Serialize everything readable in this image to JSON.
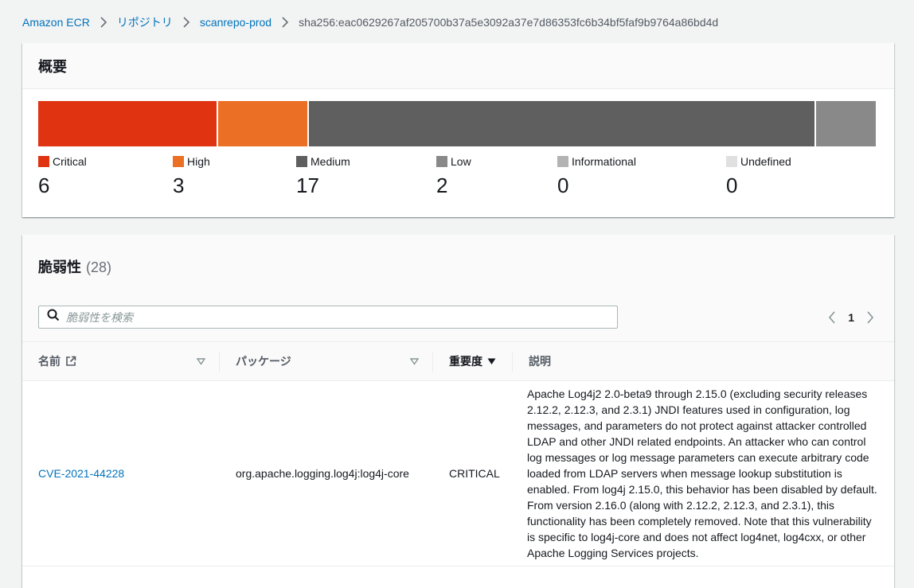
{
  "breadcrumb": {
    "items": [
      "Amazon ECR",
      "リポジトリ",
      "scanrepo-prod"
    ],
    "current": "sha256:eac0629267af205700b37a5e3092a37e7d86353fc6b34bf5faf9b9764a86bd4d"
  },
  "summary": {
    "title": "概要",
    "severities": [
      {
        "label": "Critical",
        "count": "6",
        "color": "#df3312"
      },
      {
        "label": "High",
        "count": "3",
        "color": "#eb6f24"
      },
      {
        "label": "Medium",
        "count": "17",
        "color": "#5f5f5f"
      },
      {
        "label": "Low",
        "count": "2",
        "color": "#898989"
      },
      {
        "label": "Informational",
        "count": "0",
        "color": "#b3b3b3"
      },
      {
        "label": "Undefined",
        "count": "0",
        "color": "#e0e0e0"
      }
    ]
  },
  "vulnerabilities": {
    "title": "脆弱性",
    "count": "(28)",
    "search_placeholder": "脆弱性を検索",
    "page": "1",
    "columns": {
      "name": "名前",
      "package": "パッケージ",
      "severity": "重要度",
      "description": "説明"
    },
    "rows": [
      {
        "name": "CVE-2021-44228",
        "package": "org.apache.logging.log4j:log4j-core",
        "severity": "CRITICAL",
        "description": "Apache Log4j2 2.0-beta9 through 2.15.0 (excluding security releases 2.12.2, 2.12.3, and 2.3.1) JNDI features used in configuration, log messages, and parameters do not protect against attacker controlled LDAP and other JNDI related endpoints. An attacker who can control log messages or log message parameters can execute arbitrary code loaded from LDAP servers when message lookup substitution is enabled. From log4j 2.15.0, this behavior has been disabled by default. From version 2.16.0 (along with 2.12.2, 2.12.3, and 2.3.1), this functionality has been completely removed. Note that this vulnerability is specific to log4j-core and does not affect log4net, log4cxx, or other Apache Logging Services projects."
      }
    ]
  },
  "colors": {
    "link": "#0073bb",
    "critical": "#df3312",
    "high": "#eb6f24",
    "medium": "#5f5f5f",
    "low": "#898989"
  },
  "icons": [
    "chevron-right-icon",
    "search-icon",
    "chevron-left-icon",
    "external-link-icon",
    "sort-down-icon",
    "sort-caret-icon"
  ]
}
